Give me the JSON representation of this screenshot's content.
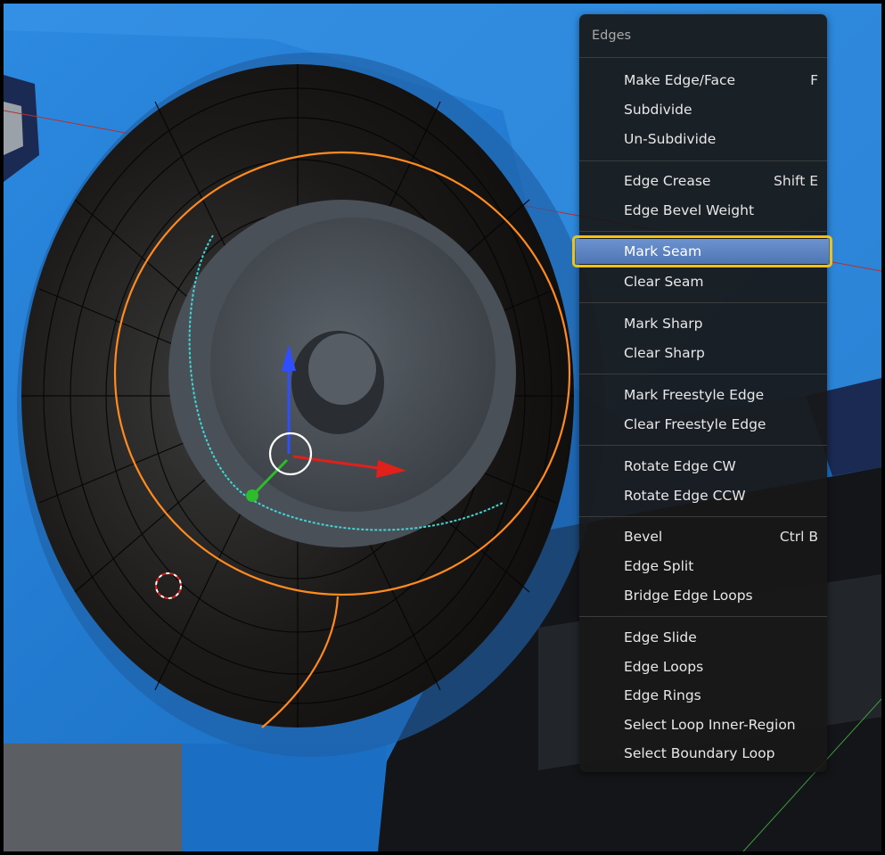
{
  "menu": {
    "title": "Edges",
    "groups": [
      [
        {
          "label": "Make Edge/Face",
          "shortcut": "F"
        },
        {
          "label": "Subdivide",
          "shortcut": ""
        },
        {
          "label": "Un-Subdivide",
          "shortcut": ""
        }
      ],
      [
        {
          "label": "Edge Crease",
          "shortcut": "Shift E"
        },
        {
          "label": "Edge Bevel Weight",
          "shortcut": ""
        }
      ],
      [
        {
          "label": "Mark Seam",
          "shortcut": "",
          "highlighted": true
        },
        {
          "label": "Clear Seam",
          "shortcut": ""
        }
      ],
      [
        {
          "label": "Mark Sharp",
          "shortcut": ""
        },
        {
          "label": "Clear Sharp",
          "shortcut": ""
        }
      ],
      [
        {
          "label": "Mark Freestyle Edge",
          "shortcut": ""
        },
        {
          "label": "Clear Freestyle Edge",
          "shortcut": ""
        }
      ],
      [
        {
          "label": "Rotate Edge CW",
          "shortcut": ""
        },
        {
          "label": "Rotate Edge CCW",
          "shortcut": ""
        }
      ],
      [
        {
          "label": "Bevel",
          "shortcut": "Ctrl B"
        },
        {
          "label": "Edge Split",
          "shortcut": ""
        },
        {
          "label": "Bridge Edge Loops",
          "shortcut": ""
        }
      ],
      [
        {
          "label": "Edge Slide",
          "shortcut": ""
        },
        {
          "label": "Edge Loops",
          "shortcut": ""
        },
        {
          "label": "Edge Rings",
          "shortcut": ""
        },
        {
          "label": "Select Loop Inner-Region",
          "shortcut": ""
        },
        {
          "label": "Select Boundary Loop",
          "shortcut": ""
        }
      ]
    ]
  },
  "colors": {
    "highlight": "#5a82c0",
    "highlight_outline": "#f2c114",
    "selected_edge": "#ff8a1e",
    "seam_edge": "#3fd6d6",
    "viewport_blue": "#1a6fc4"
  },
  "icons": [
    "3d-cursor-icon",
    "transform-gizmo-icon",
    "arrow-x-icon",
    "arrow-y-icon",
    "arrow-z-icon"
  ]
}
